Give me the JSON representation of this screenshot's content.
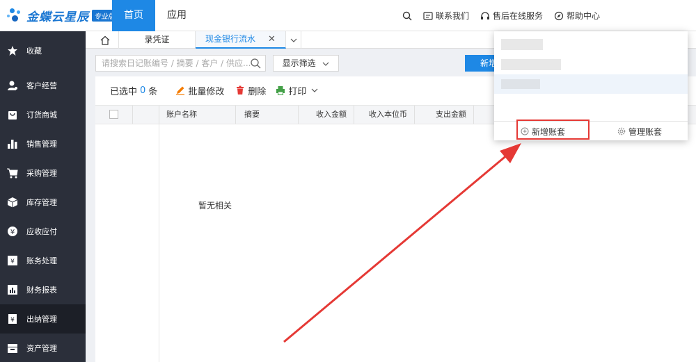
{
  "brand": {
    "name": "金蝶云星辰",
    "badge": "专业版"
  },
  "top_nav": {
    "home": "首页",
    "app": "应用"
  },
  "top_tools": {
    "contact": "联系我们",
    "service": "售后在线服务",
    "help": "帮助中心"
  },
  "sidebar": {
    "items": [
      {
        "label": "收藏",
        "icon": "star-icon"
      },
      {
        "label": "客户经营",
        "icon": "user-icon"
      },
      {
        "label": "订货商城",
        "icon": "bag-icon"
      },
      {
        "label": "销售管理",
        "icon": "bar-chart-icon"
      },
      {
        "label": "采购管理",
        "icon": "cart-icon"
      },
      {
        "label": "库存管理",
        "icon": "box-icon"
      },
      {
        "label": "应收应付",
        "icon": "yen-coin-icon"
      },
      {
        "label": "账务处理",
        "icon": "ledger-icon"
      },
      {
        "label": "财务报表",
        "icon": "report-icon"
      },
      {
        "label": "出纳管理",
        "icon": "cashier-icon"
      },
      {
        "label": "资产管理",
        "icon": "asset-icon"
      }
    ],
    "active_index": 9
  },
  "tabs": {
    "tab1": "录凭证",
    "tab2": "现金银行流水"
  },
  "search": {
    "placeholder": "请搜索日记账编号 / 摘要 / 客户 / 供应..."
  },
  "filter_label": "显示筛选",
  "new_button_label": "新增",
  "toolbar": {
    "selected_prefix": "已选中",
    "selected_count": "0",
    "selected_suffix": "条",
    "batch_edit": "批量修改",
    "delete": "删除",
    "print": "打印"
  },
  "table": {
    "columns": [
      "账户名称",
      "摘要",
      "收入金额",
      "收入本位币",
      "支出金额"
    ],
    "empty_text": "暂无相关"
  },
  "popup": {
    "add_set": "新增账套",
    "manage_set": "管理账套"
  },
  "colors": {
    "accent": "#1e88e5",
    "sidebar_bg": "#2b2f3a",
    "annotation": "#e53935"
  }
}
